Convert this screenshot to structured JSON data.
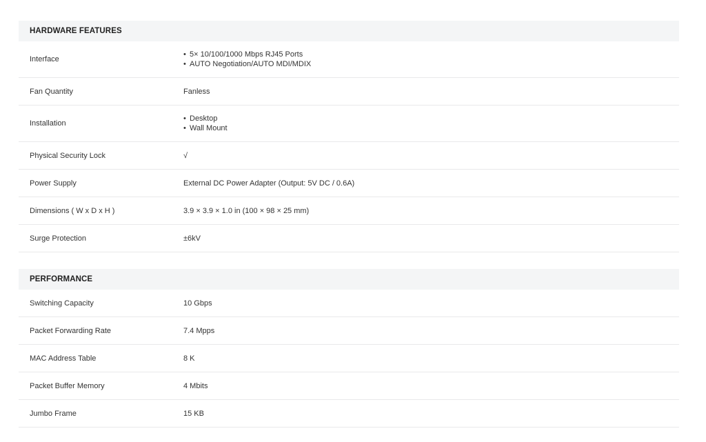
{
  "sections": [
    {
      "title": "HARDWARE FEATURES",
      "rows": [
        {
          "label": "Interface",
          "lines": [
            "5× 10/100/1000 Mbps RJ45 Ports",
            "AUTO Negotiation/AUTO MDI/MDIX"
          ]
        },
        {
          "label": "Fan Quantity",
          "value": "Fanless"
        },
        {
          "label": "Installation",
          "lines": [
            "Desktop",
            "Wall Mount"
          ]
        },
        {
          "label": "Physical Security Lock",
          "value": "√"
        },
        {
          "label": "Power Supply",
          "value": "External DC Power Adapter (Output: 5V DC / 0.6A)"
        },
        {
          "label": "Dimensions ( W x D x H )",
          "value": "3.9 × 3.9 × 1.0 in (100 × 98 × 25 mm)"
        },
        {
          "label": "Surge Protection",
          "value": "±6kV"
        }
      ]
    },
    {
      "title": "PERFORMANCE",
      "rows": [
        {
          "label": "Switching Capacity",
          "value": "10 Gbps"
        },
        {
          "label": "Packet Forwarding Rate",
          "value": "7.4 Mpps"
        },
        {
          "label": "MAC Address Table",
          "value": "8 K"
        },
        {
          "label": "Packet Buffer Memory",
          "value": "4 Mbits"
        },
        {
          "label": "Jumbo Frame",
          "value": "15 KB"
        }
      ]
    }
  ]
}
